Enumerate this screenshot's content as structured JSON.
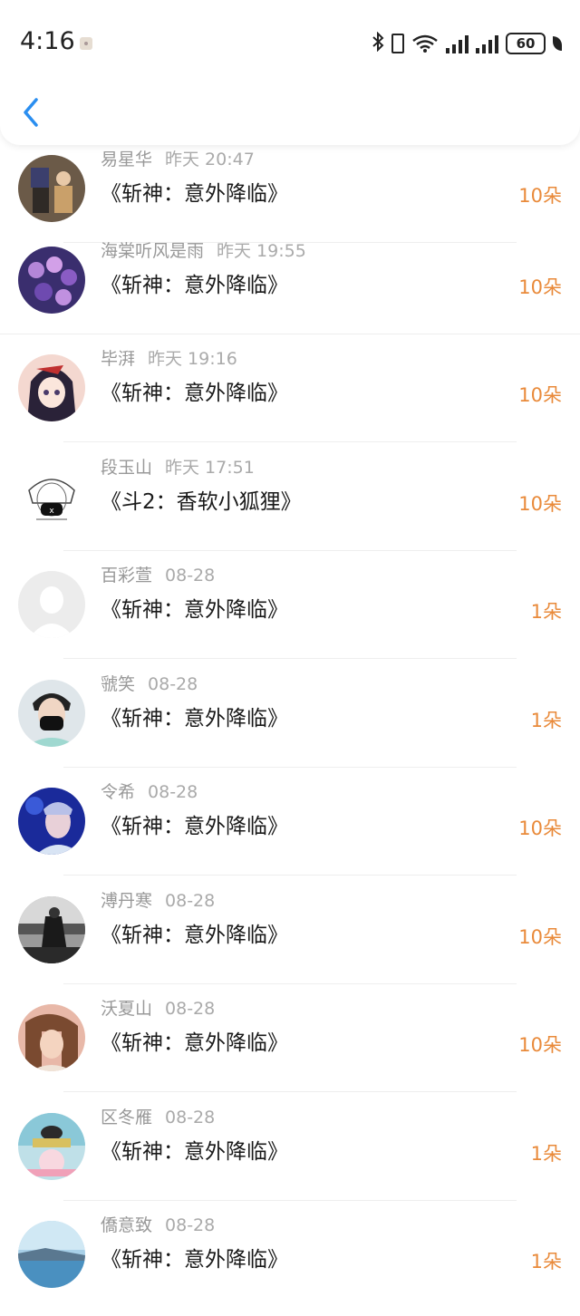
{
  "status_bar": {
    "time": "4:16",
    "battery": "60",
    "icons": [
      "notification-icon",
      "bluetooth-icon",
      "vibrate-icon",
      "wifi-icon",
      "signal-icon",
      "signal-icon",
      "battery-icon",
      "power-save-icon"
    ]
  },
  "header": {
    "back_icon": "back-chevron-icon"
  },
  "colors": {
    "flowers": "#e98a3a",
    "back_icon": "#2a8ef0",
    "name": "#999999"
  },
  "items": [
    {
      "name": "易星华",
      "time": "昨天 20:47",
      "title": "《斩神：意外降临》",
      "flowers": "10朵",
      "avatar": "photo"
    },
    {
      "name": "海棠听风是雨",
      "time": "昨天 19:55",
      "title": "《斩神：意外降临》",
      "flowers": "10朵",
      "avatar": "photo"
    },
    {
      "name": "毕湃",
      "time": "昨天 19:16",
      "title": "《斩神：意外降临》",
      "flowers": "10朵",
      "avatar": "photo"
    },
    {
      "name": "段玉山",
      "time": "昨天 17:51",
      "title": "《斗2：香软小狐狸》",
      "flowers": "10朵",
      "avatar": "photo"
    },
    {
      "name": "百彩萱",
      "time": "08-28",
      "title": "《斩神：意外降临》",
      "flowers": "1朵",
      "avatar": "default"
    },
    {
      "name": "虢笑",
      "time": "08-28",
      "title": "《斩神：意外降临》",
      "flowers": "1朵",
      "avatar": "photo"
    },
    {
      "name": "令希",
      "time": "08-28",
      "title": "《斩神：意外降临》",
      "flowers": "10朵",
      "avatar": "photo"
    },
    {
      "name": "溥丹寒",
      "time": "08-28",
      "title": "《斩神：意外降临》",
      "flowers": "10朵",
      "avatar": "photo"
    },
    {
      "name": "沃夏山",
      "time": "08-28",
      "title": "《斩神：意外降临》",
      "flowers": "10朵",
      "avatar": "photo"
    },
    {
      "name": "区冬雁",
      "time": "08-28",
      "title": "《斩神：意外降临》",
      "flowers": "1朵",
      "avatar": "photo"
    },
    {
      "name": "僑意致",
      "time": "08-28",
      "title": "《斩神：意外降临》",
      "flowers": "1朵",
      "avatar": "photo"
    }
  ]
}
